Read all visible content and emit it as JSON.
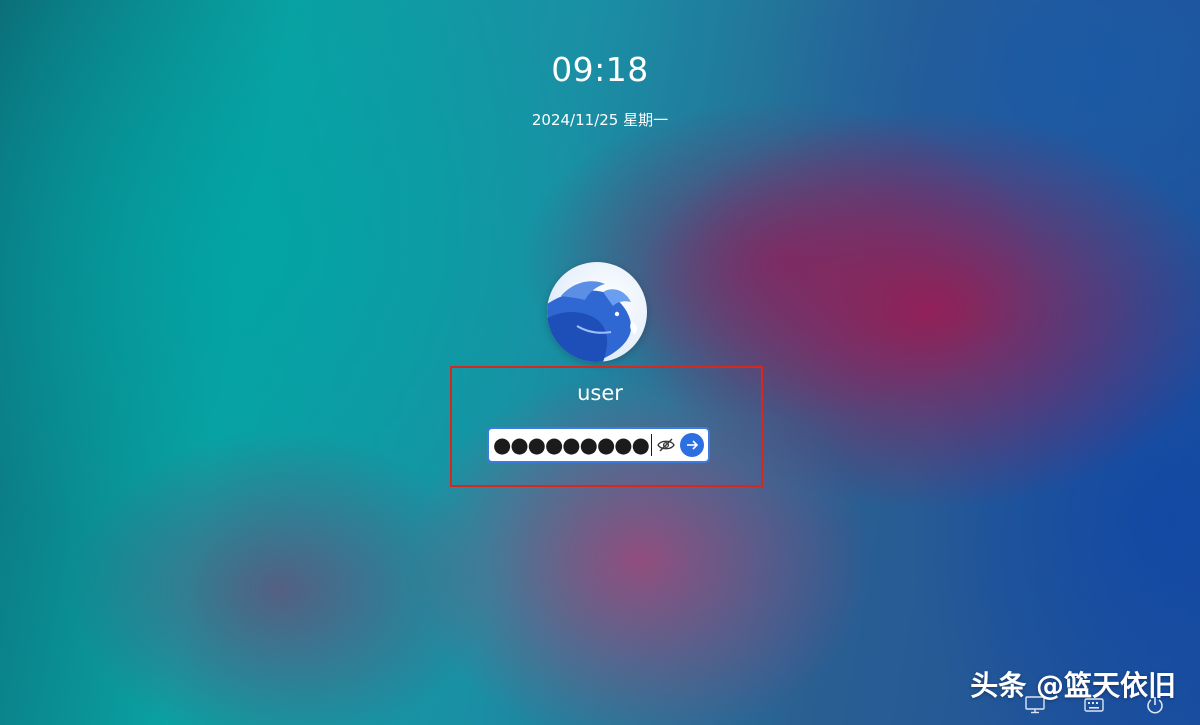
{
  "clock": {
    "time": "09:18",
    "date": "2024/11/25 星期一"
  },
  "user": {
    "avatar_icon": "dragon-avatar-icon",
    "name": "user"
  },
  "password": {
    "masked_value": "●●●●●●●●●",
    "toggle_icon": "eye-hidden-icon",
    "submit_icon": "arrow-right-icon"
  },
  "tray": {
    "icons": [
      "screen-icon",
      "keyboard-icon",
      "power-icon"
    ]
  },
  "watermark": {
    "text": "头条 @篮天依旧"
  },
  "colors": {
    "accent": "#2c6fe0",
    "highlight_border": "#d42a1e",
    "field_border": "#3d7be0"
  }
}
